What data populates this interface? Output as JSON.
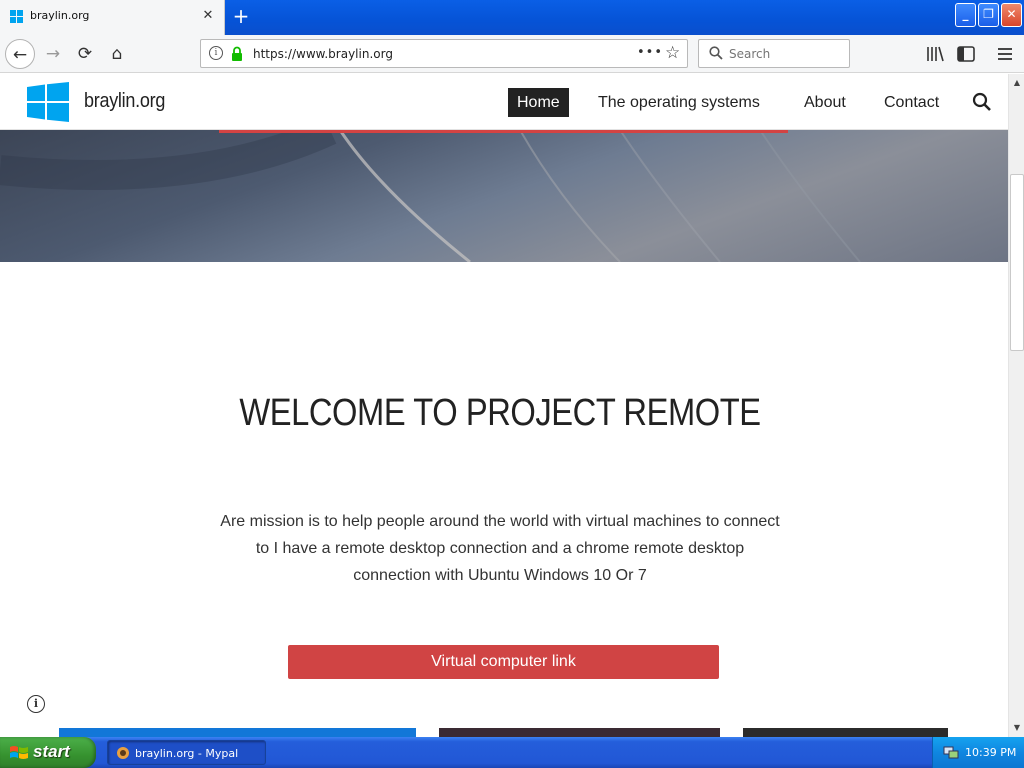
{
  "browser": {
    "tab": {
      "title": "braylin.org",
      "close": "✕"
    },
    "new_tab": "+",
    "window_buttons": {
      "minimize": "_",
      "restore": "❐",
      "close": "✕"
    },
    "nav": {
      "back": "←",
      "forward": "→",
      "reload": "⟳",
      "home": "⌂"
    },
    "url": "https://www.braylin.org",
    "page_actions": "•••",
    "bookmark_star": "☆",
    "search_placeholder": "Search"
  },
  "site": {
    "brand": "braylin.org",
    "menu": [
      {
        "label": "Home",
        "active": true
      },
      {
        "label": "The operating systems",
        "active": false
      },
      {
        "label": "About",
        "active": false
      },
      {
        "label": "Contact",
        "active": false
      }
    ],
    "heading": "WELCOME TO PROJECT REMOTE",
    "mission": "Are mission is to help people around the world with virtual machines to connect to I have a remote desktop connection and a chrome remote desktop connection with Ubuntu Windows 10 Or 7",
    "cta_label": "Virtual computer link",
    "info_fab": "i"
  },
  "taskbar": {
    "start_label": "start",
    "item_label": "braylin.org - Mypal",
    "clock": "10:39 PM"
  },
  "colors": {
    "accent_red": "#d04444",
    "logo_blue": "#00a4ef",
    "taskbar_blue": "#245edb"
  }
}
